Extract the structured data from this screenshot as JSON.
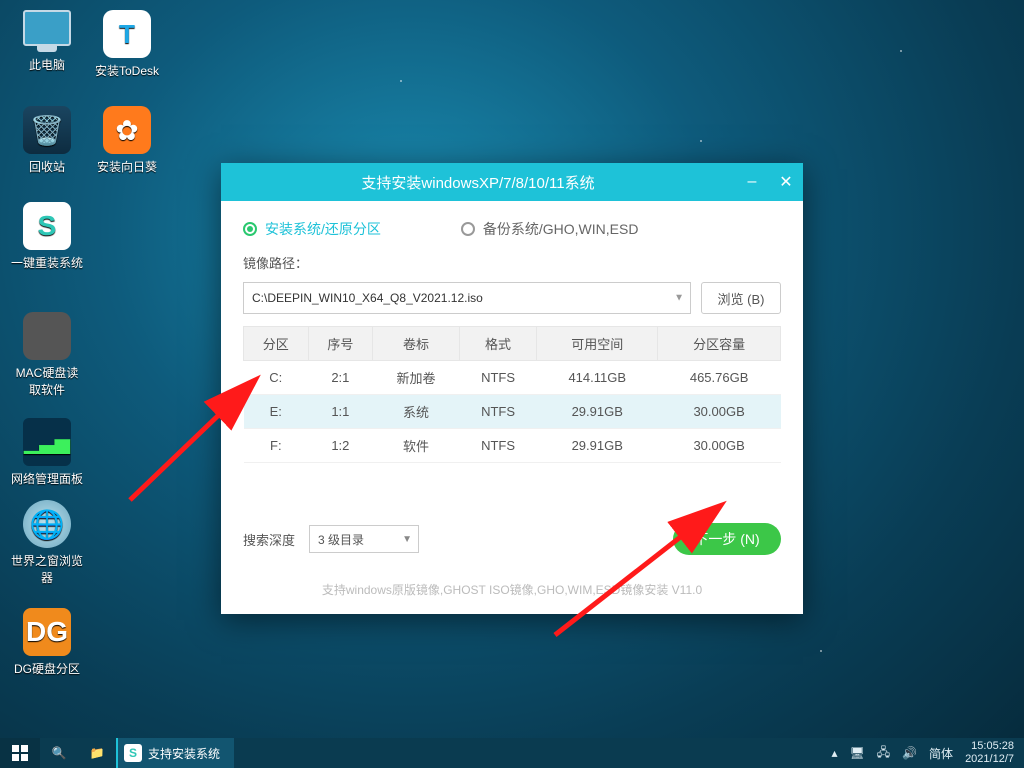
{
  "desktop_icons": {
    "this_pc": "此电脑",
    "todesk": "安装ToDesk",
    "recycle": "回收站",
    "sunflower": "安装向日葵",
    "reinstall": "一键重装系统",
    "mac_reader": "MAC硬盘读取软件",
    "net_panel": "网络管理面板",
    "world_browser": "世界之窗浏览器",
    "dg": "DG硬盘分区"
  },
  "window": {
    "title": "支持安装windowsXP/7/8/10/11系统",
    "tab_install": "安装系统/还原分区",
    "tab_backup": "备份系统/GHO,WIN,ESD",
    "image_path_label": "镜像路径：",
    "image_path": "C:\\DEEPIN_WIN10_X64_Q8_V2021.12.iso",
    "browse": "浏览 (B)",
    "headers": [
      "分区",
      "序号",
      "卷标",
      "格式",
      "可用空间",
      "分区容量"
    ],
    "rows": [
      {
        "part": "C:",
        "idx": "2:1",
        "label": "新加卷",
        "fs": "NTFS",
        "free": "414.11GB",
        "total": "465.76GB"
      },
      {
        "part": "E:",
        "idx": "1:1",
        "label": "系统",
        "fs": "NTFS",
        "free": "29.91GB",
        "total": "30.00GB"
      },
      {
        "part": "F:",
        "idx": "1:2",
        "label": "软件",
        "fs": "NTFS",
        "free": "29.91GB",
        "total": "30.00GB"
      }
    ],
    "search_depth_label": "搜索深度",
    "search_depth_value": "3 级目录",
    "next_label": "下一步 (N)",
    "footer": "支持windows原版镜像,GHOST ISO镜像,GHO,WIM,ESD镜像安装 V11.0"
  },
  "taskbar": {
    "task_label": "支持安装系统",
    "ime": "简体",
    "time": "15:05:28",
    "date": "2021/12/7"
  }
}
